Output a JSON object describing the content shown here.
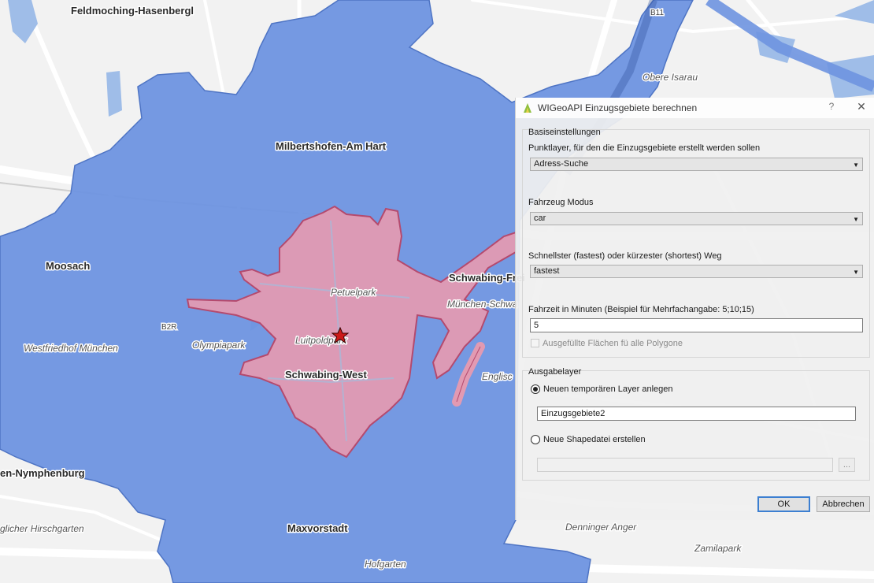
{
  "map": {
    "colors": {
      "background": "#f2f2f2",
      "isochrone_large": "#6e94e0",
      "isochrone_small": "#e29ab2",
      "road": "#ffffff",
      "water": "#9fbde8",
      "marker": "#cc1a1a"
    },
    "labels": {
      "feldmoching": "Feldmoching-Hasenbergl",
      "milbertshofen": "Milbertshofen-Am Hart",
      "moosach": "Moosach",
      "schwabing_west": "Schwabing-West",
      "schwabing_frei": "Schwabing-Frei",
      "nymphenburg": "en-Nymphenburg",
      "maxvorstadt": "Maxvorstadt",
      "petuelpark": "Petuelpark",
      "luitpoldpark": "Luitpoldpark",
      "olympiapark": "Olympiapark",
      "westfriedhof": "Westfriedhof München",
      "hirschgarten": "glicher Hirschgarten",
      "hofgarten": "Hofgarten",
      "obere_isarau": "Obere Isarau",
      "englischer": "Englisc",
      "muenchen_schwa": "München-Schwa",
      "denninger": "Denninger Anger",
      "zamilapark": "Zamilapark",
      "b2r": "B2R",
      "b11": "B11"
    }
  },
  "dialog": {
    "title": "WIGeoAPI Einzugsgebiete berechnen",
    "help_label": "?",
    "close_label": "✕",
    "basis": {
      "group_title": "Basiseinstellungen",
      "punktlayer_label": "Punktlayer, für den die Einzugsgebiete erstellt werden sollen",
      "punktlayer_value": "Adress-Suche",
      "fahrzeug_label": "Fahrzeug Modus",
      "fahrzeug_value": "car",
      "weg_label": "Schnellster (fastest) oder kürzester (shortest) Weg",
      "weg_value": "fastest",
      "fahrzeit_label": "Fahrzeit in Minuten  (Beispiel für Mehrfachangabe: 5;10;15)",
      "fahrzeit_value": "5",
      "filled_label": "Ausgefüllte Flächen fü alle Polygone",
      "filled_checked": false
    },
    "ausgabe": {
      "group_title": "Ausgabelayer",
      "temp_label": "Neuen temporären Layer anlegen",
      "temp_selected": true,
      "layer_name": "Einzugsgebiete2",
      "shape_label": "Neue Shapedatei erstellen",
      "shape_selected": false,
      "shape_path": "",
      "browse_label": "..."
    },
    "ok_label": "OK",
    "cancel_label": "Abbrechen"
  }
}
